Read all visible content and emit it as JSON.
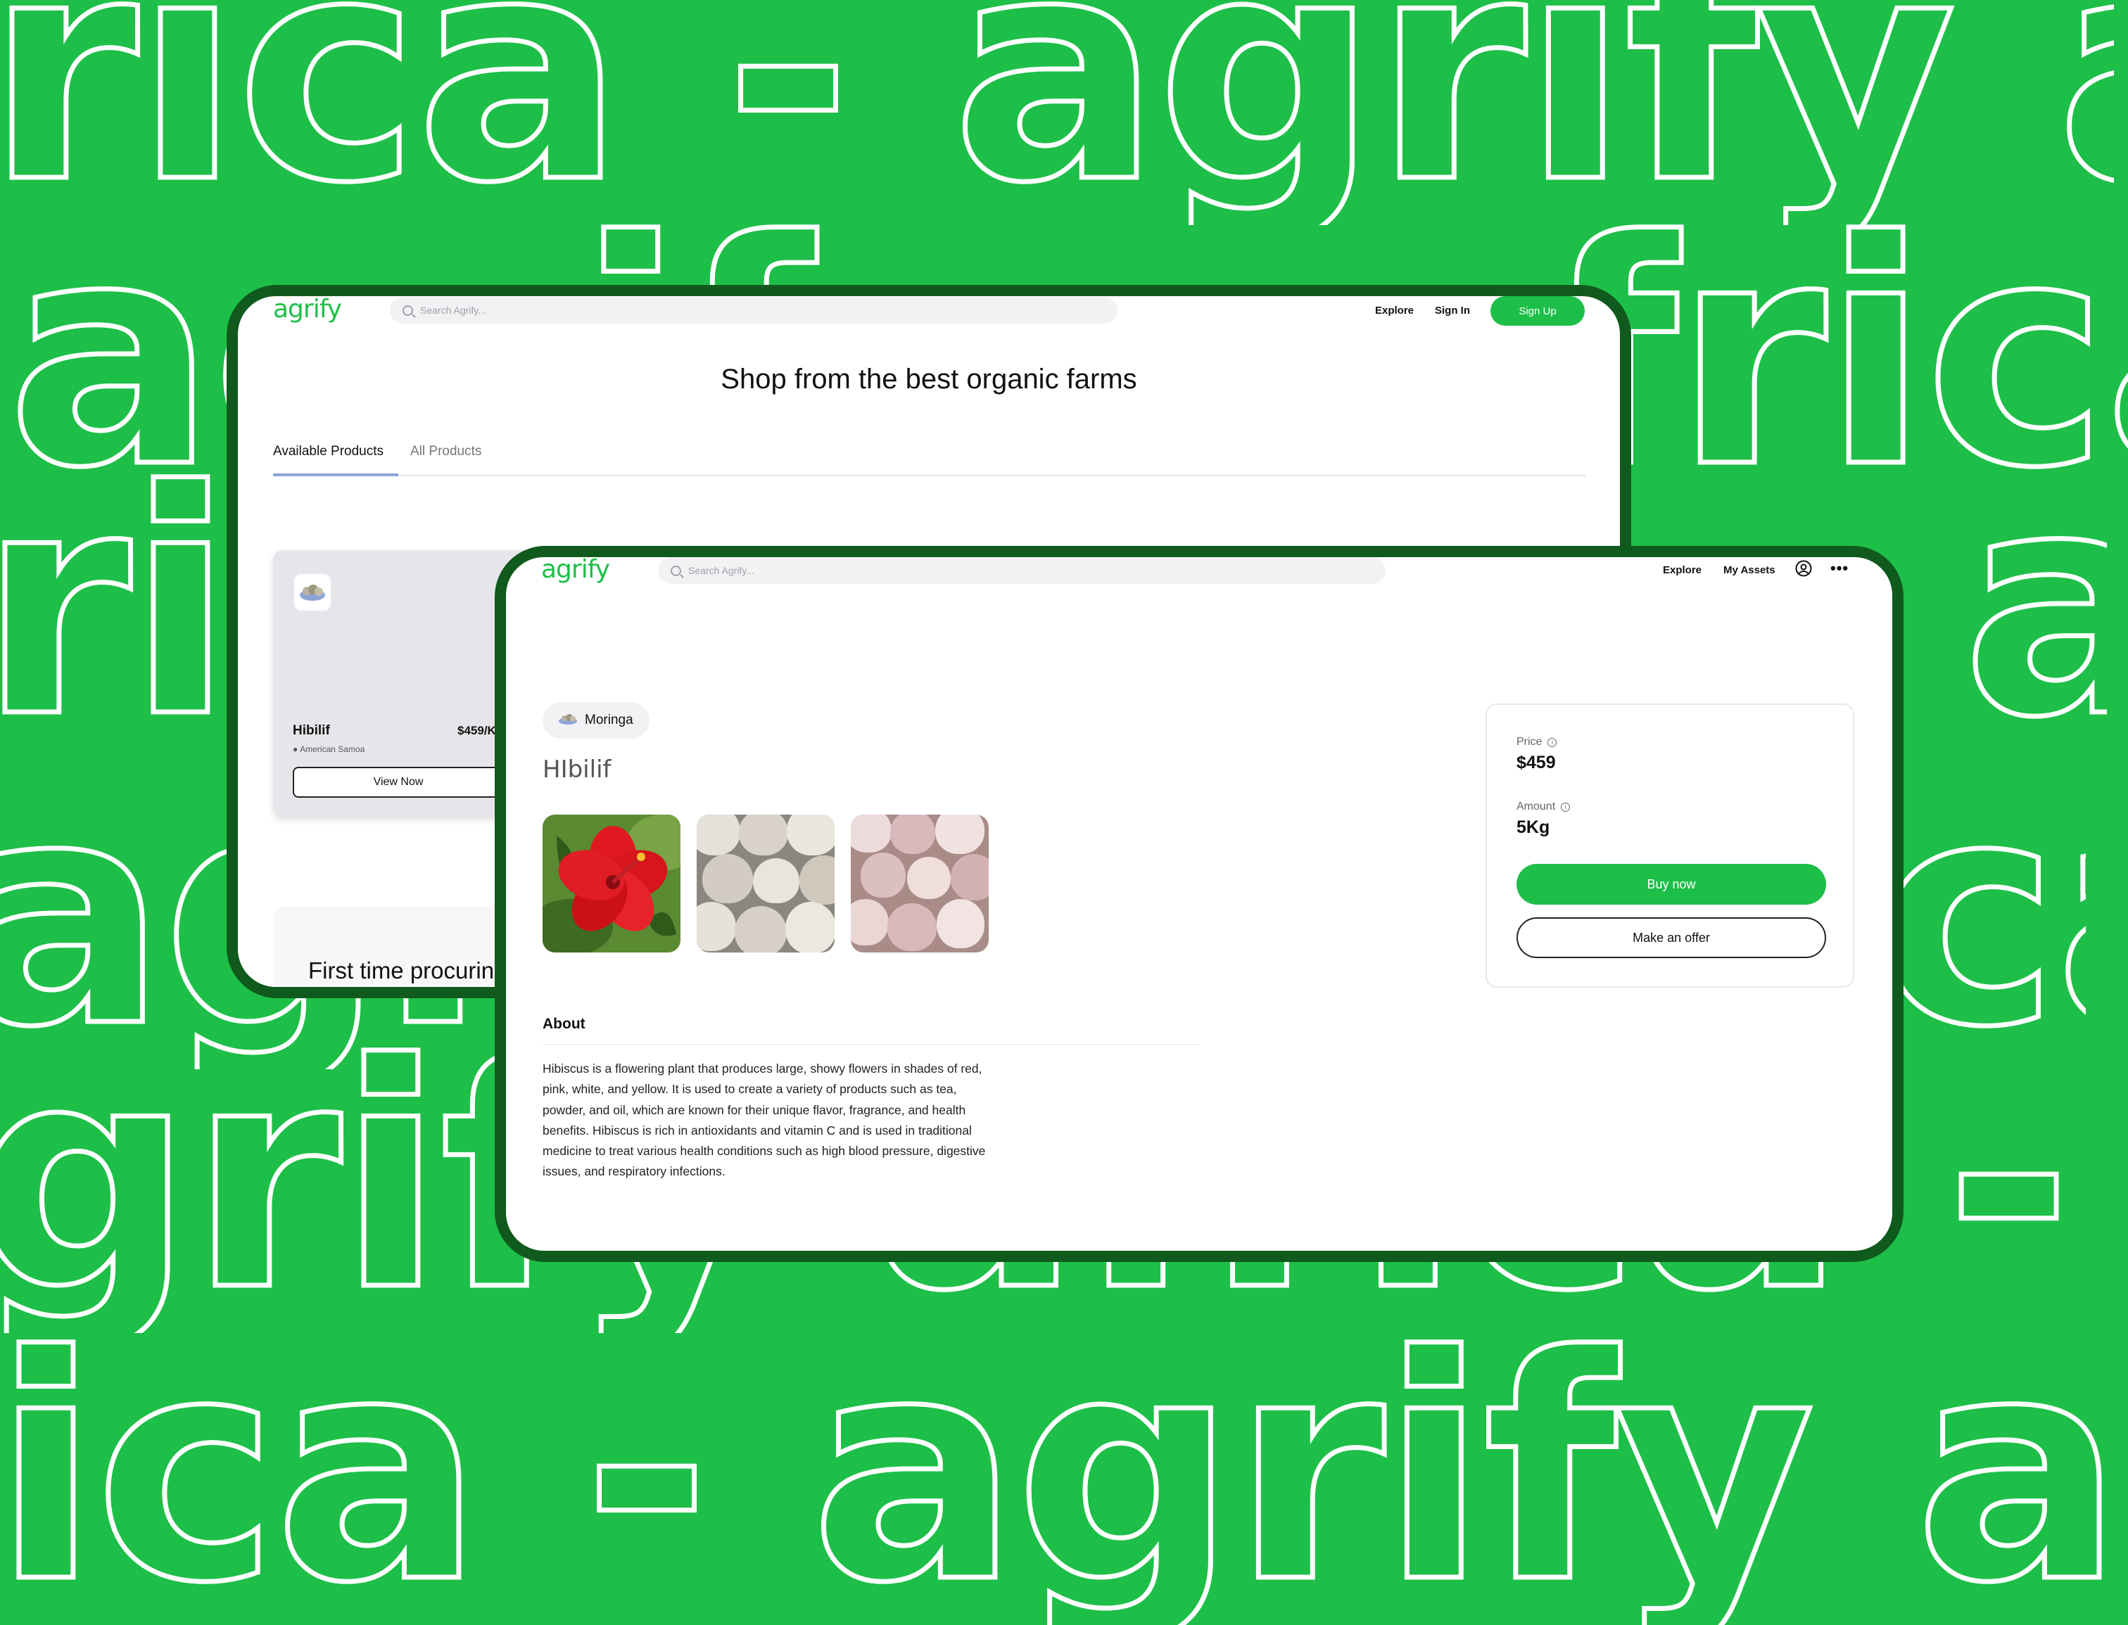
{
  "background": {
    "rows": [
      "rica - agrify africa - agrify africa",
      "agrify - africa - agrify - africa",
      "rify africa - agrify africa - agrify",
      "agrify - africa - agrify - africa",
      "grify africa - agrify africa - agrify",
      "ica - agrify africa - agrify africa"
    ]
  },
  "colors": {
    "brand_green": "#1dbf48",
    "frame_dark": "#0f5a1c",
    "text": "#111111"
  },
  "back_screen": {
    "logo": "agrify",
    "search_placeholder": "Search Agrify...",
    "nav": {
      "explore": "Explore",
      "sign_in": "Sign In",
      "sign_up": "Sign Up"
    },
    "headline": "Shop from the best organic farms",
    "tabs": [
      "Available Products",
      "All Products"
    ],
    "product_card": {
      "name": "Hibilif",
      "price": "$459/K",
      "location": "American Samoa",
      "button": "View Now",
      "icon": "produce-thumbnail-icon"
    },
    "promo_title": "First time procurin"
  },
  "front_screen": {
    "logo": "agrify",
    "search_placeholder": "Search Agrify...",
    "nav": {
      "explore": "Explore",
      "my_assets": "My Assets",
      "profile_icon": "user-circle-icon",
      "more_icon": "more-dots-icon"
    },
    "category_chip": "Moringa",
    "product_title": "HIbilif",
    "gallery": [
      "hibiscus-flower-photo",
      "garlic-bulbs-photo",
      "pink-garlic-photo"
    ],
    "about_heading": "About",
    "about_text": "Hibiscus is a flowering plant that produces large, showy flowers in shades of red, pink, white, and yellow. It is used to create a variety of products such as tea, powder, and oil, which are known for their unique flavor, fragrance, and health benefits. Hibiscus is rich in antioxidants and vitamin C and is used in traditional medicine to treat various health conditions such as high blood pressure, digestive issues, and respiratory infections.",
    "price_panel": {
      "price_label": "Price",
      "price_value": "$459",
      "amount_label": "Amount",
      "amount_value": "5Kg",
      "buy_button": "Buy now",
      "offer_button": "Make an offer"
    }
  }
}
